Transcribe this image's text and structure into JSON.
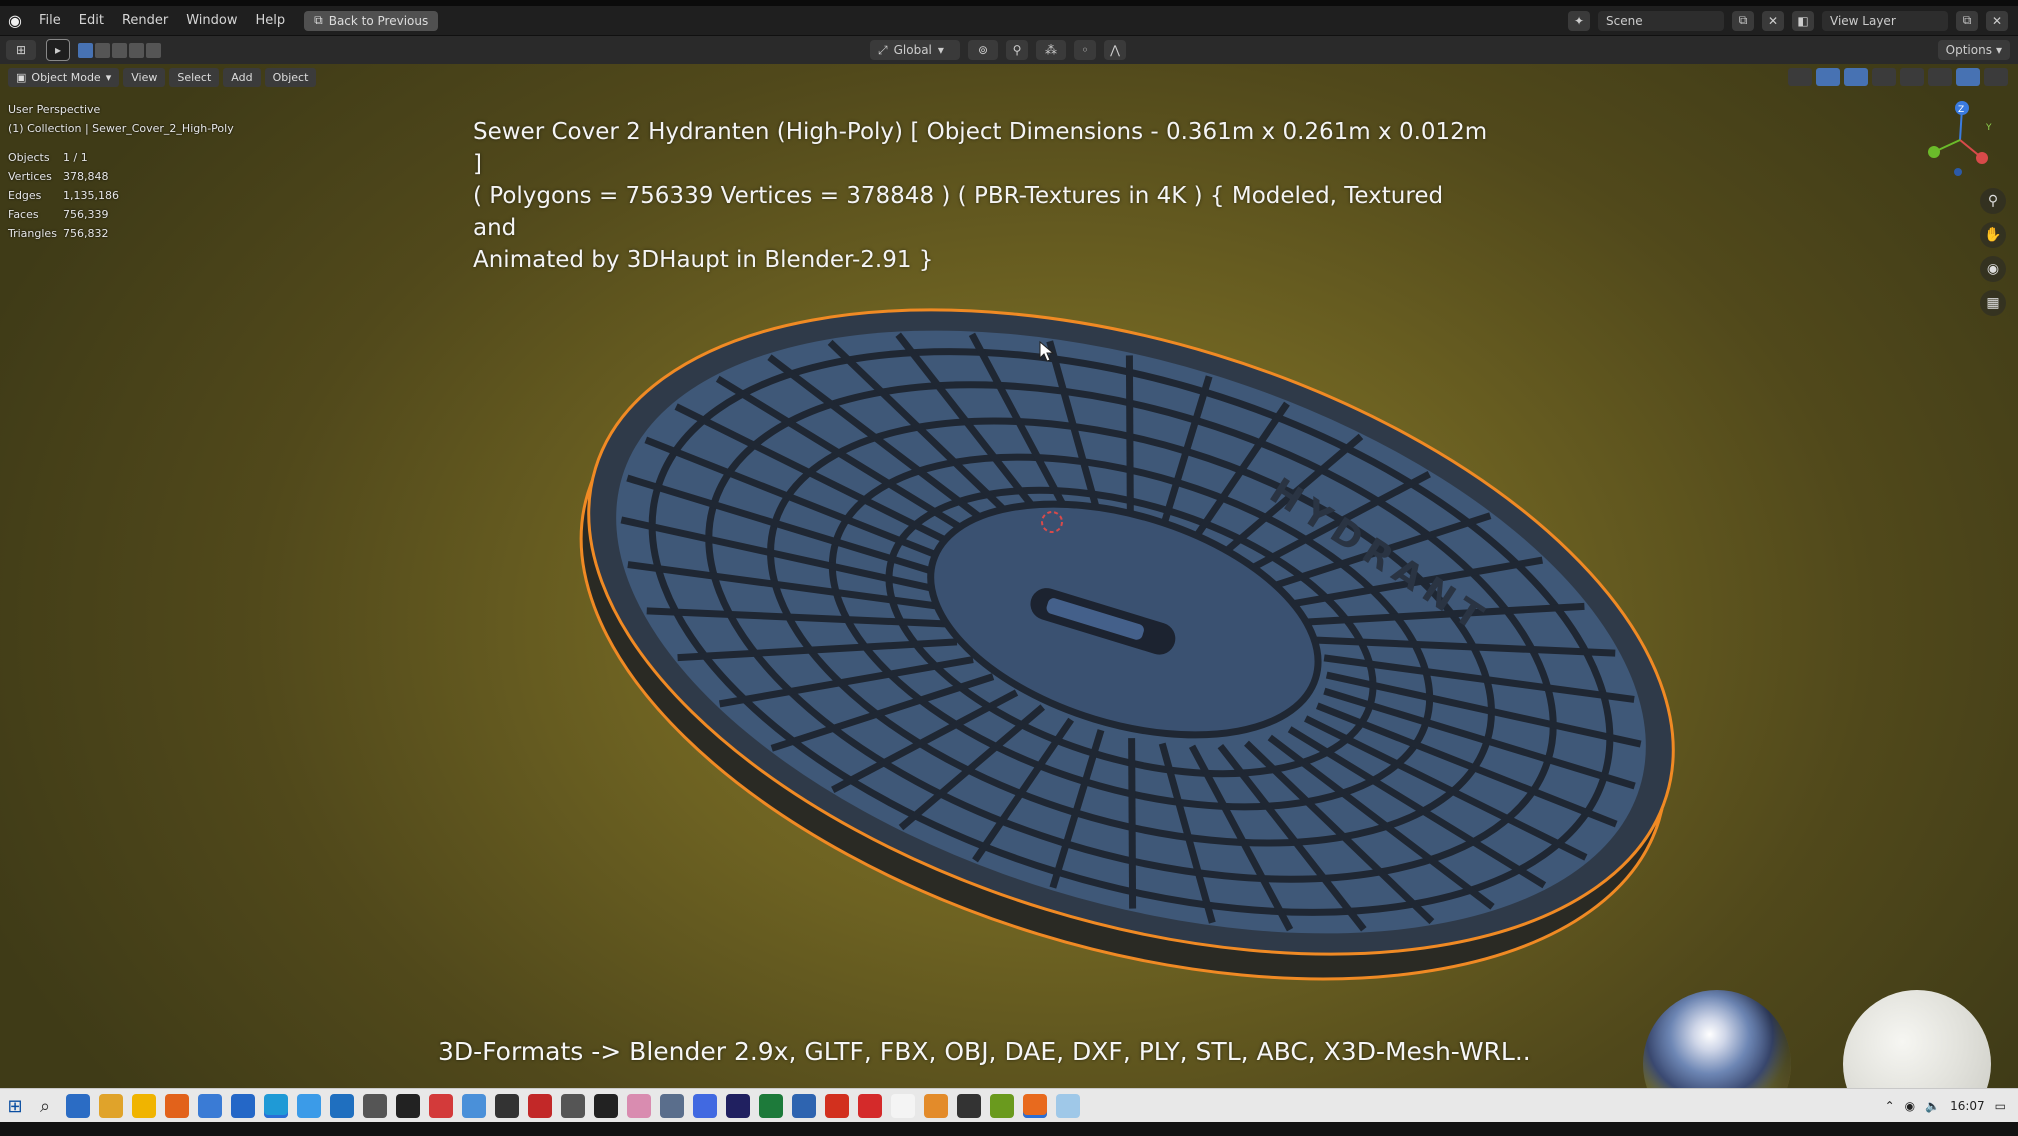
{
  "topbar": {
    "menu": [
      "File",
      "Edit",
      "Render",
      "Window",
      "Help"
    ],
    "back_button": "Back to Previous",
    "scene": "Scene",
    "view_layer": "View Layer"
  },
  "toolheader": {
    "orientation": "Global",
    "options": "Options"
  },
  "viewport": {
    "mode": "Object Mode",
    "menus": [
      "View",
      "Select",
      "Add",
      "Object"
    ],
    "perspective": "User Perspective",
    "collection": "(1) Collection | Sewer_Cover_2_High-Poly",
    "stats": [
      {
        "label": "Objects",
        "value": "1 / 1"
      },
      {
        "label": "Vertices",
        "value": "378,848"
      },
      {
        "label": "Edges",
        "value": "1,135,186"
      },
      {
        "label": "Faces",
        "value": "756,339"
      },
      {
        "label": "Triangles",
        "value": "756,832"
      }
    ],
    "overlay_lines": [
      "Sewer Cover 2 Hydranten (High-Poly) [ Object Dimensions -  0.361m x 0.261m x 0.012m ]",
      "( Polygons = 756339 Vertices = 378848 ) ( PBR-Textures in 4K ) { Modeled, Textured and",
      "Animated by 3DHaupt in Blender-2.91 }"
    ],
    "cover_text": "HYDRANT",
    "formats_line": "3D-Formats -> Blender 2.9x, GLTF, FBX, OBJ, DAE, DXF, PLY, STL, ABC, X3D-Mesh-WRL..",
    "gizmo_axes": {
      "z": "Z",
      "y": "Y"
    }
  },
  "taskbar": {
    "time": "16:07",
    "app_colors": [
      "#2b6cc4",
      "#e0a32a",
      "#f0b400",
      "#e2621b",
      "#3a7bd5",
      "#2467c7",
      "#1f9ad6",
      "#3b9be8",
      "#1f6fbf",
      "#555555",
      "#222222",
      "#d33a3a",
      "#4a90d9",
      "#333333",
      "#c22828",
      "#555555",
      "#222222",
      "#d98cb0",
      "#5a6e8c",
      "#4169e1",
      "#202060",
      "#1d7a3a",
      "#2e64b0",
      "#d2301e",
      "#d42a2a",
      "#f4f4f4",
      "#e38b2a",
      "#333333",
      "#6a9a1e",
      "#e86a1e",
      "#9fc8e8"
    ]
  },
  "colors": {
    "accent": "#4772b3",
    "selection_outline": "#f08a24",
    "cover_blue": "#3f5878"
  }
}
